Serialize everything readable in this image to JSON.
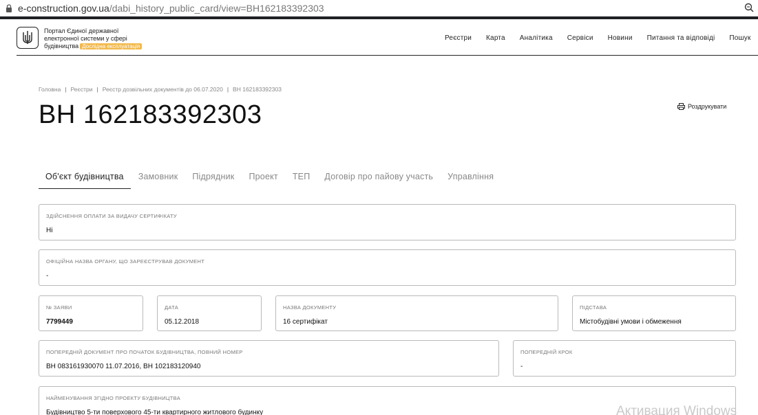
{
  "browser": {
    "url_host": "e-construction.gov.ua",
    "url_path": "/dabi_history_public_card/view=BH162183392303"
  },
  "header": {
    "logo_line1": "Портал Єдиної державної",
    "logo_line2": "електронної системи у сфері",
    "logo_line3": "будівництва",
    "beta_badge": "Дослідна експлуатація",
    "nav": [
      "Реєстри",
      "Карта",
      "Аналітика",
      "Сервіси",
      "Новини",
      "Питання та відповіді",
      "Пошук"
    ]
  },
  "breadcrumb": {
    "items": [
      "Головна",
      "Реєстри",
      "Реєстр дозвільних документів до 06.07.2020",
      "ВН 162183392303"
    ]
  },
  "page": {
    "title": "ВН 162183392303",
    "print_label": "Роздрукувати"
  },
  "tabs": [
    "Об'єкт будівництва",
    "Замовник",
    "Підрядник",
    "Проект",
    "ТЕП",
    "Договір про пайову участь",
    "Управління"
  ],
  "fields": {
    "payment": {
      "label": "Здійснення оплати за видачу сертифікату",
      "value": "Ні"
    },
    "authority": {
      "label": "Офіційна назва органу, що зареєстрував документ",
      "value": "-"
    },
    "application_no": {
      "label": "№ заяви",
      "value": "7799449"
    },
    "date": {
      "label": "Дата",
      "value": "05.12.2018"
    },
    "doc_name": {
      "label": "Назва документу",
      "value": "16 сертифікат"
    },
    "basis": {
      "label": "Підстава",
      "value": "Містобудівні умови і обмеження"
    },
    "prev_doc": {
      "label": "Попередній документ про початок будівництва, повний номер",
      "value": "ВН 083161930070 11.07.2016, ВН 102183120940"
    },
    "prev_step": {
      "label": "Попередній крок",
      "value": "-"
    },
    "project_name": {
      "label": "Найменування згідно проекту будівництва",
      "value": "Будівництво 5-ти поверхового 45-ти квартирного житлового будинку"
    }
  },
  "watermark": "Активация Windows"
}
